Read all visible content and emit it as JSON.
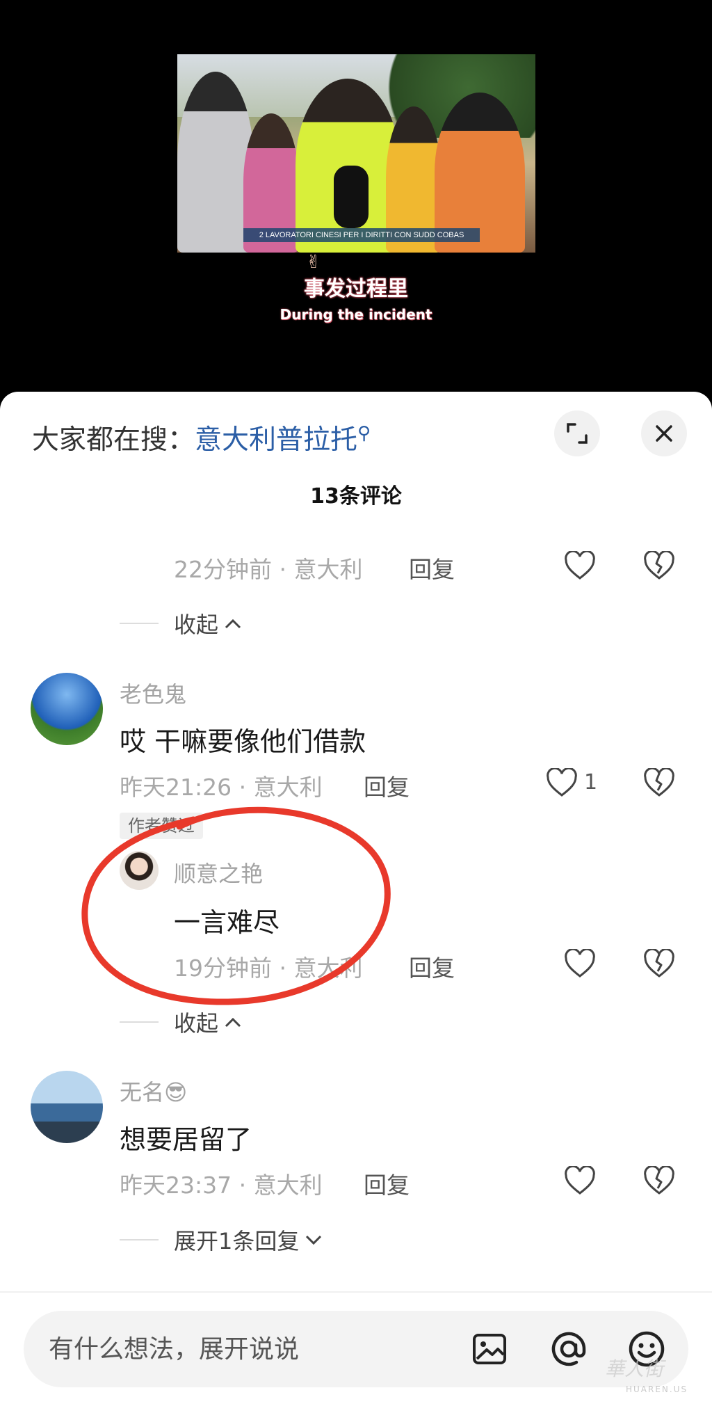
{
  "video": {
    "caption_strip": "2 LAVORATORI CINESI PER I DIRITTI CON SUDD COBAS",
    "subtitle_cn": "事发过程里",
    "subtitle_en": "During the incident"
  },
  "sheet": {
    "search_prefix": "大家都在搜：",
    "search_term": "意大利普拉托",
    "comment_count": "13条评论"
  },
  "comments": {
    "top_reply": {
      "meta": "22分钟前 · 意大利",
      "reply": "回复"
    },
    "fold1": "收起",
    "c1": {
      "name": "老色鬼",
      "text": "哎 干嘛要像他们借款",
      "meta": "昨天21:26 · 意大利",
      "reply": "回复",
      "likes": "1",
      "liked_tag": "作者赞过"
    },
    "r1": {
      "name": "顺意之艳",
      "text": "一言难尽",
      "meta": "19分钟前 · 意大利",
      "reply": "回复"
    },
    "fold2": "收起",
    "c2": {
      "name": "无名😎",
      "text": "想要居留了",
      "meta": "昨天23:37 · 意大利",
      "reply": "回复"
    },
    "expand": "展开1条回复"
  },
  "input": {
    "placeholder": "有什么想法，展开说说"
  },
  "watermark": {
    "main": "華人街",
    "sub": "HUAREN.US"
  },
  "colors": {
    "link": "#2b5ea6",
    "highlight_circle": "#e8392b"
  }
}
